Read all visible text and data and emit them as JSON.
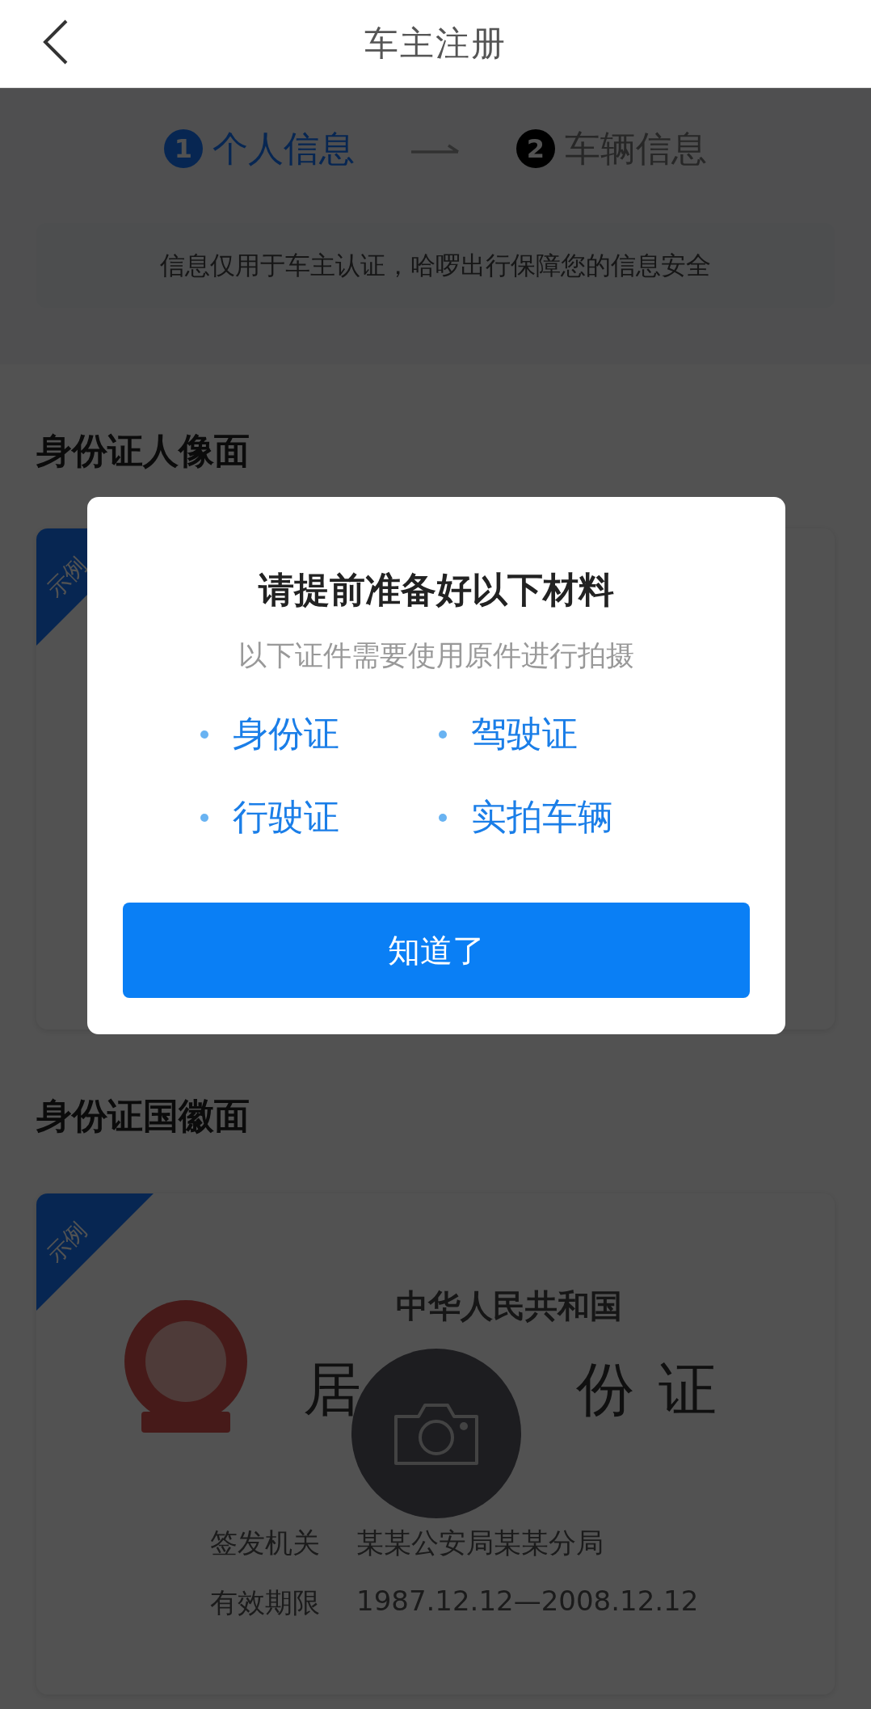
{
  "nav": {
    "title": "车主注册"
  },
  "steps": [
    {
      "number": "1",
      "label": "个人信息",
      "selected": true
    },
    {
      "number": "2",
      "label": "车辆信息",
      "selected": false
    }
  ],
  "notice": "信息仅用于车主认证，哈啰出行保障您的信息安全",
  "sections": [
    {
      "title": "身份证人像面",
      "tag": "示例"
    },
    {
      "title": "身份证国徽面",
      "tag": "示例",
      "sample": {
        "country": "中华人民共和国",
        "doc_title_parts": [
          "居",
          "份证"
        ],
        "fields": [
          {
            "label": "签发机关",
            "value": "某某公安局某某分局"
          },
          {
            "label": "有效期限",
            "value": "1987.12.12—2008.12.12"
          }
        ]
      }
    }
  ],
  "dialog": {
    "title": "请提前准备好以下材料",
    "subtitle": "以下证件需要使用原件进行拍摄",
    "items": [
      "身份证",
      "驾驶证",
      "行驶证",
      "实拍车辆"
    ],
    "button": "知道了"
  }
}
